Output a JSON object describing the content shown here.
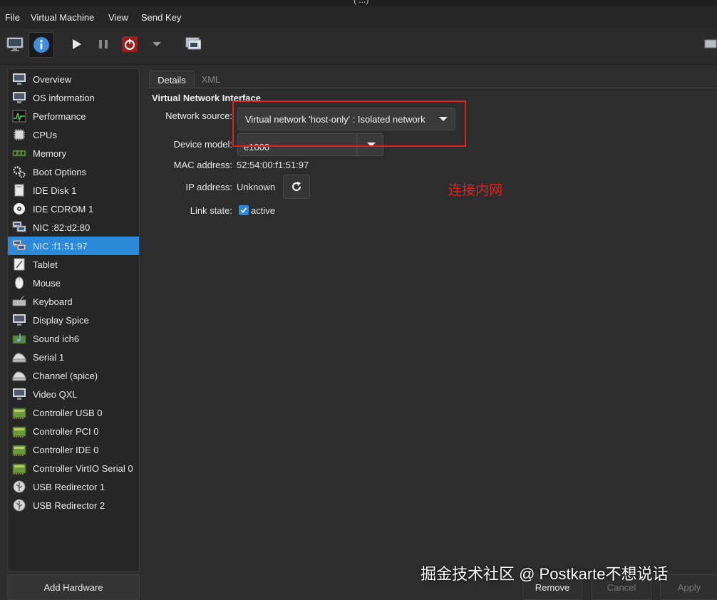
{
  "window": {
    "title_fragment": "( ...)"
  },
  "menu": [
    "File",
    "Virtual Machine",
    "View",
    "Send Key"
  ],
  "toolbar": {
    "buttons": [
      "console-icon",
      "details-icon",
      "run-icon",
      "pause-icon",
      "shutdown-icon",
      "shutdown-menu-icon",
      "snapshots-icon"
    ]
  },
  "sidebar": {
    "items": [
      {
        "label": "Overview",
        "icon": "monitor-icon"
      },
      {
        "label": "OS information",
        "icon": "monitor-icon"
      },
      {
        "label": "Performance",
        "icon": "performance-icon"
      },
      {
        "label": "CPUs",
        "icon": "cpu-icon"
      },
      {
        "label": "Memory",
        "icon": "memory-icon"
      },
      {
        "label": "Boot Options",
        "icon": "gears-icon"
      },
      {
        "label": "IDE Disk 1",
        "icon": "disk-icon"
      },
      {
        "label": "IDE CDROM 1",
        "icon": "cdrom-icon"
      },
      {
        "label": "NIC :82:d2:80",
        "icon": "network-icon"
      },
      {
        "label": "NIC :f1:51:97",
        "icon": "network-icon",
        "selected": true
      },
      {
        "label": "Tablet",
        "icon": "tablet-icon"
      },
      {
        "label": "Mouse",
        "icon": "mouse-icon"
      },
      {
        "label": "Keyboard",
        "icon": "keyboard-icon"
      },
      {
        "label": "Display Spice",
        "icon": "monitor-icon"
      },
      {
        "label": "Sound ich6",
        "icon": "sound-icon"
      },
      {
        "label": "Serial 1",
        "icon": "serial-icon"
      },
      {
        "label": "Channel (spice)",
        "icon": "serial-icon"
      },
      {
        "label": "Video QXL",
        "icon": "monitor-icon"
      },
      {
        "label": "Controller USB 0",
        "icon": "controller-icon"
      },
      {
        "label": "Controller PCI 0",
        "icon": "controller-icon"
      },
      {
        "label": "Controller IDE 0",
        "icon": "controller-icon"
      },
      {
        "label": "Controller VirtIO Serial 0",
        "icon": "controller-icon"
      },
      {
        "label": "USB Redirector 1",
        "icon": "usb-icon"
      },
      {
        "label": "USB Redirector 2",
        "icon": "usb-icon"
      }
    ],
    "add_hardware": "Add Hardware"
  },
  "tabs": [
    {
      "label": "Details",
      "active": true
    },
    {
      "label": "XML",
      "active": false
    }
  ],
  "nic": {
    "section_title": "Virtual Network Interface",
    "network_source_label": "Network source:",
    "network_source_value": "Virtual network 'host-only' : Isolated network",
    "device_model_label": "Device model:",
    "device_model_value": "e1000",
    "mac_label": "MAC address:",
    "mac_value": "52:54:00:f1:51:97",
    "ip_label": "IP address:",
    "ip_value": "Unknown",
    "link_label": "Link state:",
    "link_value": "active",
    "link_checked": true
  },
  "annotation": {
    "text": "连接内网",
    "color": "#e02020"
  },
  "buttons": {
    "remove": "Remove",
    "cancel": "Cancel",
    "apply": "Apply"
  },
  "watermark": "掘金技术社区 @ Postkarte不想说话",
  "colors": {
    "selection": "#2a8ad8",
    "background": "#2d2d2d"
  }
}
